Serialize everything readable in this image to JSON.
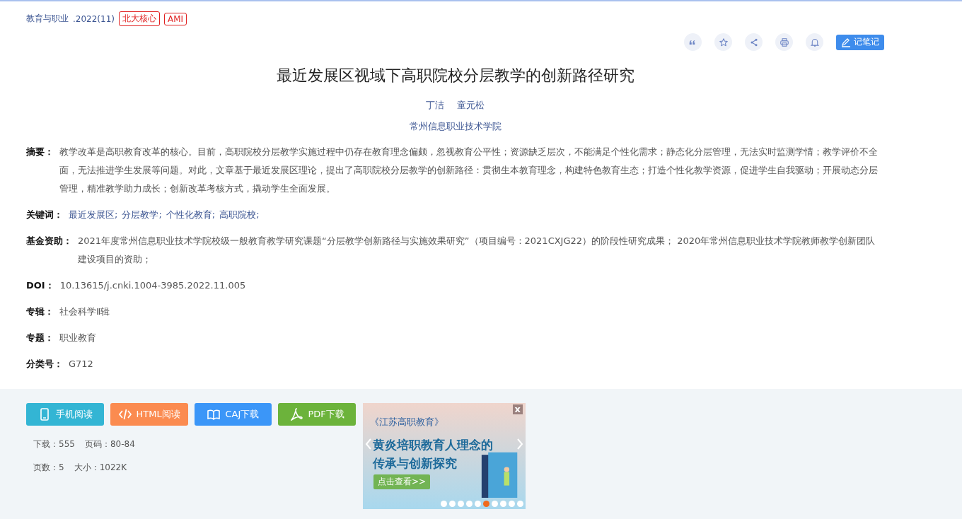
{
  "source": {
    "journal": "教育与职业",
    "issue": ".2022(11)",
    "tags": [
      "北大核心",
      "AMI"
    ]
  },
  "toolbar": {
    "note_button": "记笔记"
  },
  "title": "最近发展区视域下高职院校分层教学的创新路径研究",
  "authors": [
    "丁洁",
    "童元松"
  ],
  "affiliation": "常州信息职业技术学院",
  "fields": [
    {
      "label": "摘要：",
      "kind": "text",
      "value": "教学改革是高职教育改革的核心。目前，高职院校分层教学实施过程中仍存在教育理念偏颇，忽视教育公平性；资源缺乏层次，不能满足个性化需求；静态化分层管理，无法实时监测学情；教学评价不全面，无法推进学生发展等问题。对此，文章基于最近发展区理论，提出了高职院校分层教学的创新路径：贯彻生本教育理念，构建特色教育生态；打造个性化教学资源，促进学生自我驱动；开展动态分层管理，精准教学助力成长；创新改革考核方式，撬动学生全面发展。"
    },
    {
      "label": "关键词：",
      "kind": "links",
      "links": [
        "最近发展区;",
        "分层教学;",
        "个性化教育;",
        "高职院校;"
      ]
    },
    {
      "label": "基金资助：",
      "kind": "text",
      "value": "2021年度常州信息职业技术学院校级一般教育教学研究课题“分层教学创新路径与实施效果研究”（项目编号：2021CXJG22）的阶段性研究成果； 2020年常州信息职业技术学院教师教学创新团队建设项目的资助；"
    },
    {
      "label": "DOI：",
      "kind": "text",
      "value": "10.13615/j.cnki.1004-3985.2022.11.005"
    },
    {
      "label": "专辑：",
      "kind": "text",
      "value": "社会科学Ⅱ辑"
    },
    {
      "label": "专题：",
      "kind": "text",
      "value": "职业教育"
    },
    {
      "label": "分类号：",
      "kind": "text",
      "value": "G712"
    }
  ],
  "buttons": [
    {
      "label": "手机阅读",
      "color": "#33b5d4"
    },
    {
      "label": "HTML阅读",
      "color": "#fb8b50"
    },
    {
      "label": "CAJ下载",
      "color": "#3b96f8"
    },
    {
      "label": "PDF下载",
      "color": "#6cb33b"
    }
  ],
  "stats": [
    [
      "下载：555",
      "页码：80-84"
    ],
    [
      "页数：5",
      "大小：1022K"
    ]
  ],
  "banner": {
    "close": "x",
    "journal": "《江苏高职教育》",
    "headline": [
      "黄炎培职教育人理念的",
      "传承与创新探究"
    ],
    "cta": "点击查看>>",
    "dots": [
      {
        "selected": false
      },
      {
        "selected": false
      },
      {
        "selected": false
      },
      {
        "selected": false
      },
      {
        "selected": false
      },
      {
        "selected": true
      },
      {
        "selected": false
      },
      {
        "selected": false
      },
      {
        "selected": false
      },
      {
        "selected": false
      }
    ]
  }
}
